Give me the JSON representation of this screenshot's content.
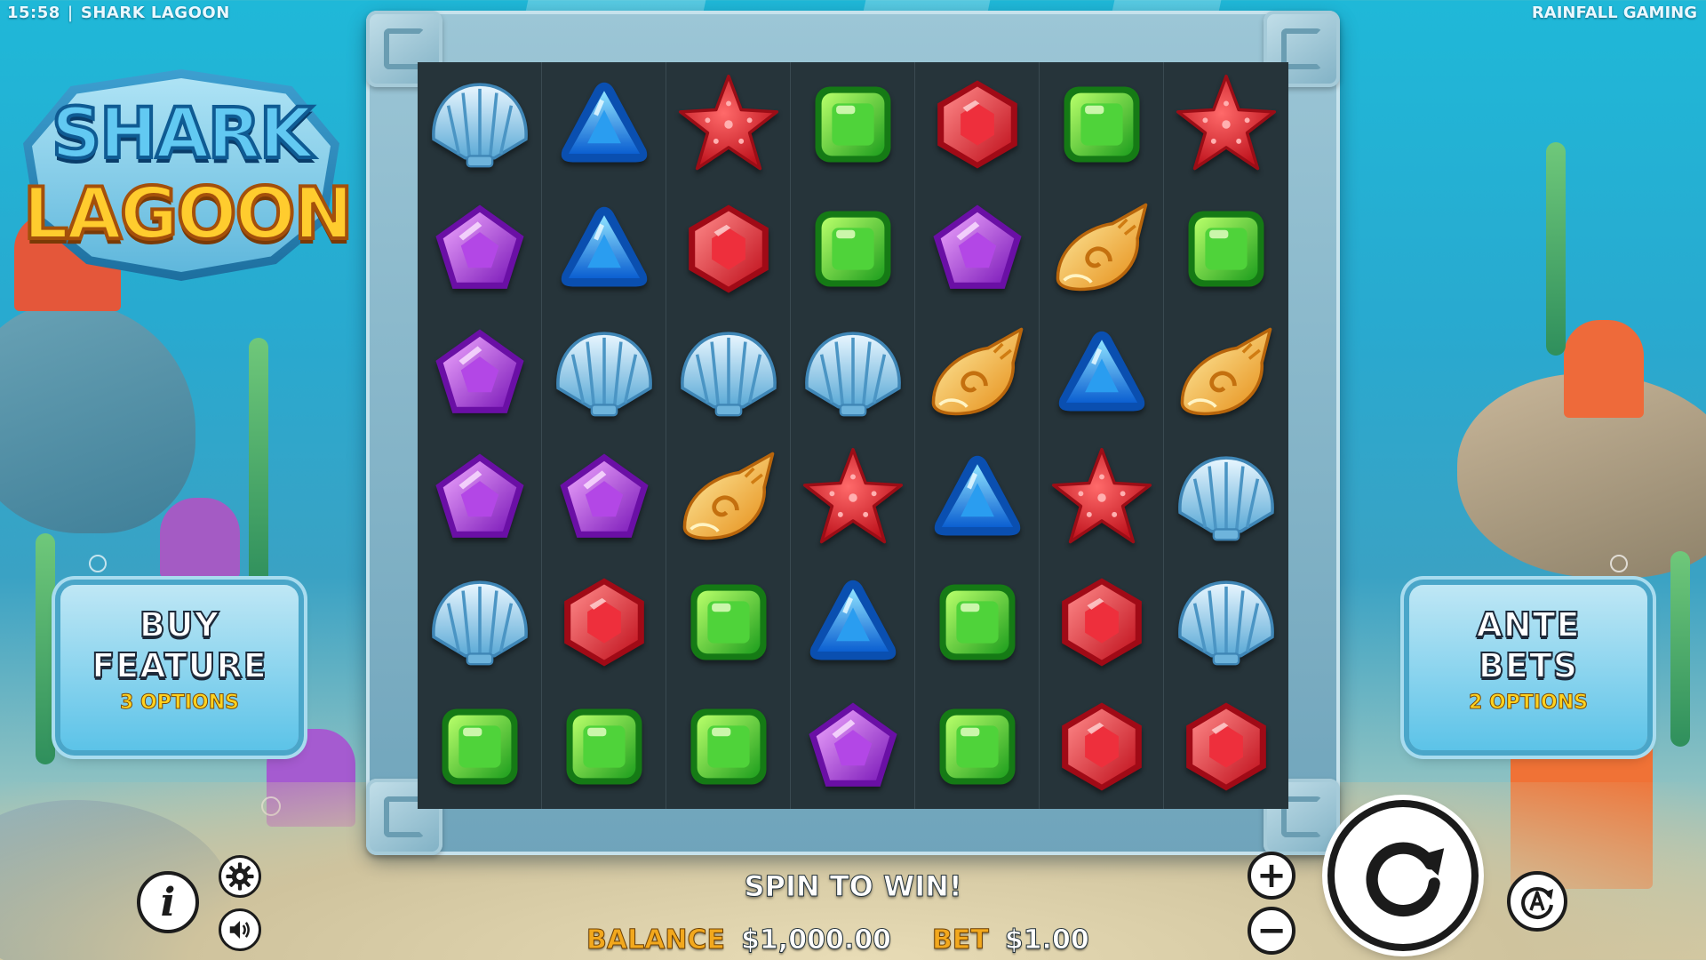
{
  "header": {
    "time": "15:58",
    "separator": "|",
    "game_title": "SHARK LAGOON",
    "provider": "RAINFALL GAMING"
  },
  "logo": {
    "line1": "SHARK",
    "line2": "LAGOON"
  },
  "grid": {
    "columns": 7,
    "rows": [
      [
        "clam-shell",
        "blue-triangle",
        "red-starfish",
        "green-square",
        "red-hexagon",
        "green-square",
        "red-starfish"
      ],
      [
        "purple-pentagon",
        "blue-triangle",
        "red-hexagon",
        "green-square",
        "purple-pentagon",
        "conch-shell",
        "green-square"
      ],
      [
        "purple-pentagon",
        "clam-shell",
        "clam-shell",
        "clam-shell",
        "conch-shell",
        "blue-triangle",
        "conch-shell"
      ],
      [
        "purple-pentagon",
        "purple-pentagon",
        "conch-shell",
        "red-starfish",
        "blue-triangle",
        "red-starfish",
        "clam-shell"
      ],
      [
        "clam-shell",
        "red-hexagon",
        "green-square",
        "blue-triangle",
        "green-square",
        "red-hexagon",
        "clam-shell"
      ],
      [
        "green-square",
        "green-square",
        "green-square",
        "purple-pentagon",
        "green-square",
        "red-hexagon",
        "red-hexagon"
      ]
    ]
  },
  "buy_feature": {
    "line1": "BUY",
    "line2": "FEATURE",
    "options": "3 OPTIONS"
  },
  "ante_bets": {
    "line1": "ANTE",
    "line2": "BETS",
    "options": "2 OPTIONS"
  },
  "controls": {
    "info_icon": "info-icon",
    "settings_icon": "gear-icon",
    "sound_icon": "speaker-icon",
    "bet_increase": "+",
    "bet_decrease": "−",
    "spin_icon": "spin-arrow-icon",
    "autoplay_icon": "autoplay-icon"
  },
  "status": {
    "message": "SPIN TO WIN!",
    "balance_label": "BALANCE",
    "balance_value": "$1,000.00",
    "bet_label": "BET",
    "bet_value": "$1.00"
  },
  "colors": {
    "balance_label": "#f2a81d",
    "option_text": "#ffd21f",
    "board_bg": "#26343a"
  }
}
